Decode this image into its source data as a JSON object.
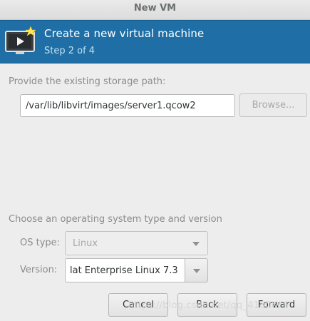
{
  "window": {
    "title": "New VM"
  },
  "banner": {
    "heading": "Create a new virtual machine",
    "step": "Step 2 of 4",
    "icon": "vm-monitor-play-icon",
    "background": "#1f6fa6"
  },
  "storage": {
    "label": "Provide the existing storage path:",
    "path_value": "/var/lib/libvirt/images/server1.qcow2",
    "browse_label": "Browse..."
  },
  "os": {
    "section_label": "Choose an operating system type and version",
    "type_label": "OS type:",
    "type_value": "Linux",
    "version_label": "Version:",
    "version_value": "lat Enterprise Linux 7.3"
  },
  "buttons": {
    "cancel": "Cancel",
    "back": "Back",
    "forward": "Forward"
  },
  "watermark": "https://blog.csdn.net/qq_4180ec4"
}
